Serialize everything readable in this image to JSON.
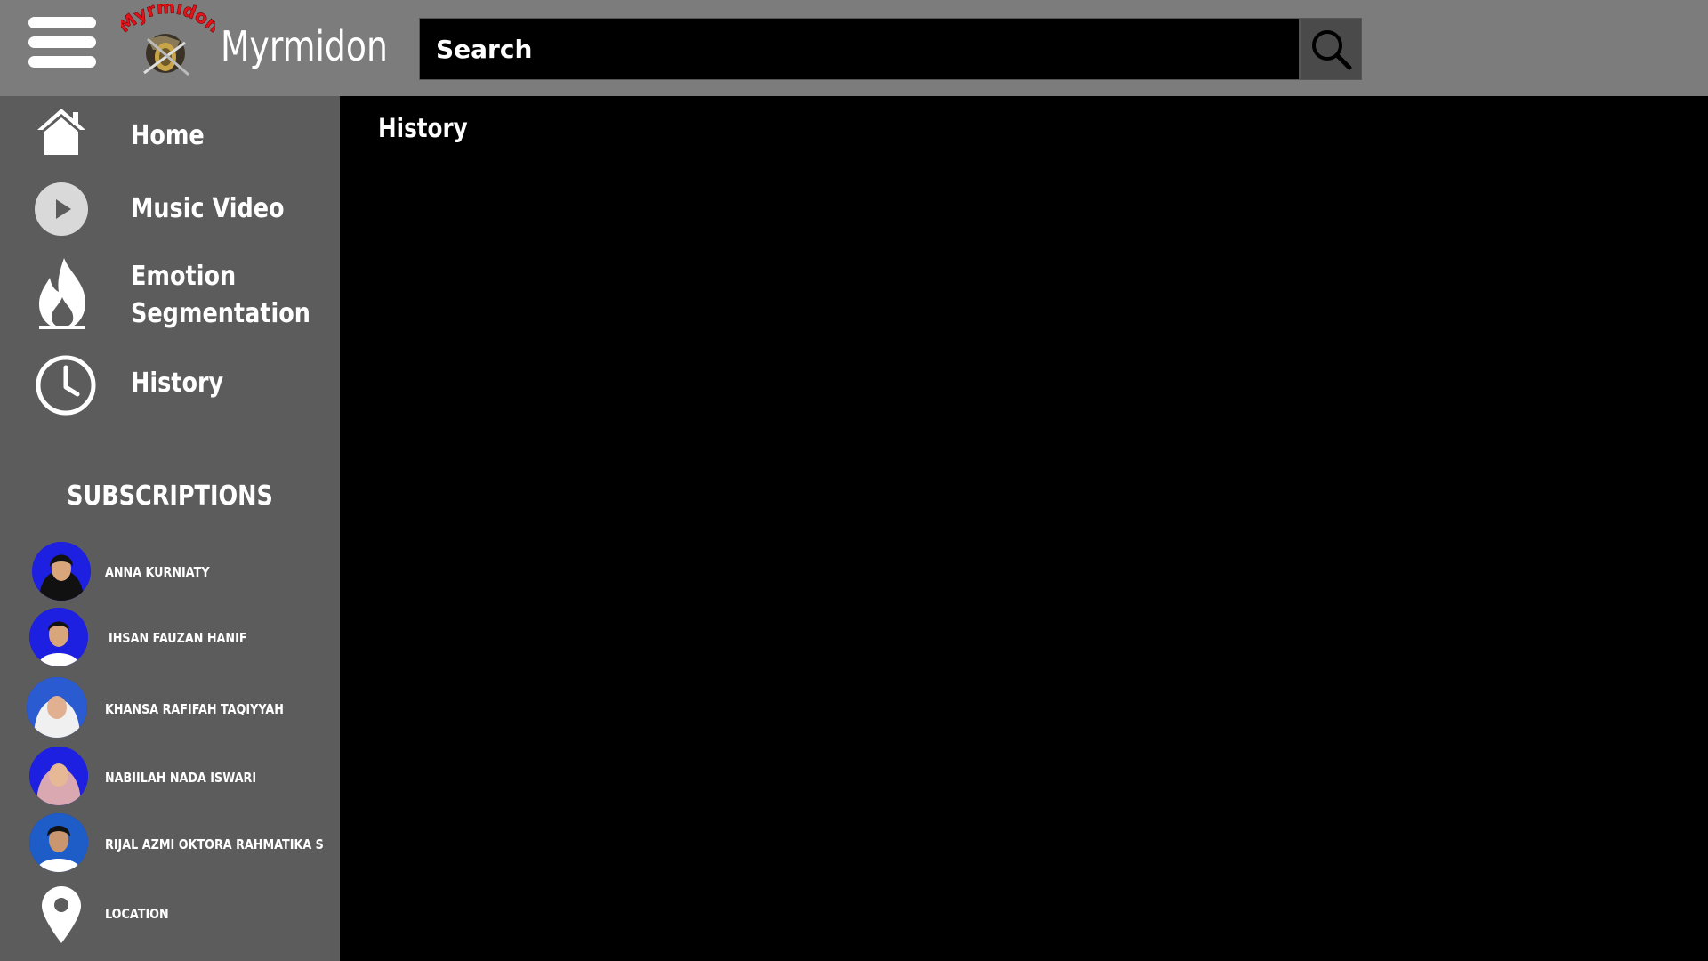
{
  "app": {
    "name": "Myrmidon",
    "logo_text": "Myrmidon"
  },
  "search": {
    "placeholder": "Search"
  },
  "sidebar": {
    "items": [
      {
        "label": "Home",
        "icon": "home-icon"
      },
      {
        "label": "Music Video",
        "icon": "play-icon"
      },
      {
        "label_line1": "Emotion",
        "label_line2": "Segmentation",
        "icon": "fire-icon"
      },
      {
        "label": "History",
        "icon": "clock-icon"
      }
    ],
    "subscriptions_title": "SUBSCRIPTIONS",
    "subscriptions": [
      {
        "name": "ANNA KURNIATY"
      },
      {
        "name": "IHSAN FAUZAN HANIF"
      },
      {
        "name": "KHANSA RAFIFAH TAQIYYAH"
      },
      {
        "name": "NABIILAH NADA ISWARI"
      },
      {
        "name": "RIJAL AZMI OKTORA RAHMATIKA S"
      }
    ],
    "location": {
      "label": "LOCATION",
      "icon": "location-pin-icon"
    }
  },
  "main": {
    "title": "History"
  },
  "colors": {
    "topbar": "#7c7c7c",
    "sidebar": "#5c5c5c",
    "main": "#000000",
    "logo_red": "#e3121b"
  }
}
